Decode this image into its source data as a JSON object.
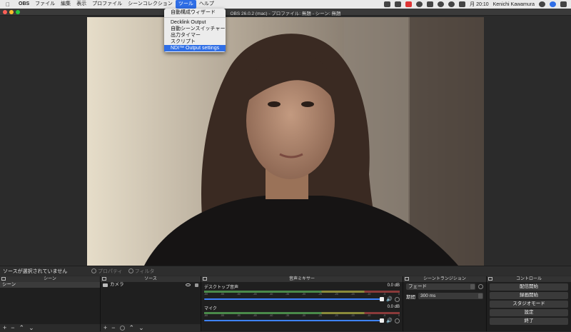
{
  "menubar": {
    "app_name": "OBS",
    "items": [
      "ファイル",
      "編集",
      "表示",
      "プロファイル",
      "シーンコレクション",
      "ツール",
      "ヘルプ"
    ],
    "status_time": "月 20:10",
    "user_name": "Kenichi Kawamura"
  },
  "window": {
    "title": "OBS 26.0.2 (mac) - プロファイル: 無題 - シーン: 無題"
  },
  "tools_menu": {
    "items": [
      "自動構成ウィザード",
      "Decklink Output",
      "自動シーンスイッチャー",
      "出力タイマー",
      "スクリプト",
      "NDI™ Output settings"
    ],
    "selected": "NDI™ Output settings"
  },
  "status_bar": {
    "message": "ソースが選択されていません",
    "properties_label": "プロパティ",
    "filters_label": "フィルタ"
  },
  "scenes_dock": {
    "title": "シーン",
    "items": [
      "シーン"
    ]
  },
  "sources_dock": {
    "title": "ソース",
    "items": [
      "カメラ"
    ]
  },
  "mixer_dock": {
    "title": "音声ミキサー",
    "channels": [
      {
        "name": "デスクトップ音声",
        "level": "0.0 dB",
        "volume": 1.0
      },
      {
        "name": "マイク",
        "level": "0.0 dB",
        "volume": 1.0
      }
    ],
    "ticks": [
      "-60",
      "-55",
      "-50",
      "-45",
      "-40",
      "-35",
      "-30",
      "-25",
      "-20",
      "-15",
      "-10",
      "-5",
      "0"
    ]
  },
  "transitions_dock": {
    "title": "シーントランジション",
    "transition": "フェード",
    "duration_label": "期間",
    "duration_value": "300 ms"
  },
  "controls_dock": {
    "title": "コントロール",
    "buttons": [
      "配信開始",
      "録画開始",
      "スタジオモード",
      "設定",
      "終了"
    ]
  },
  "colors": {
    "accent": "#2f6ee6",
    "volume_bar": "#3e83ff"
  }
}
